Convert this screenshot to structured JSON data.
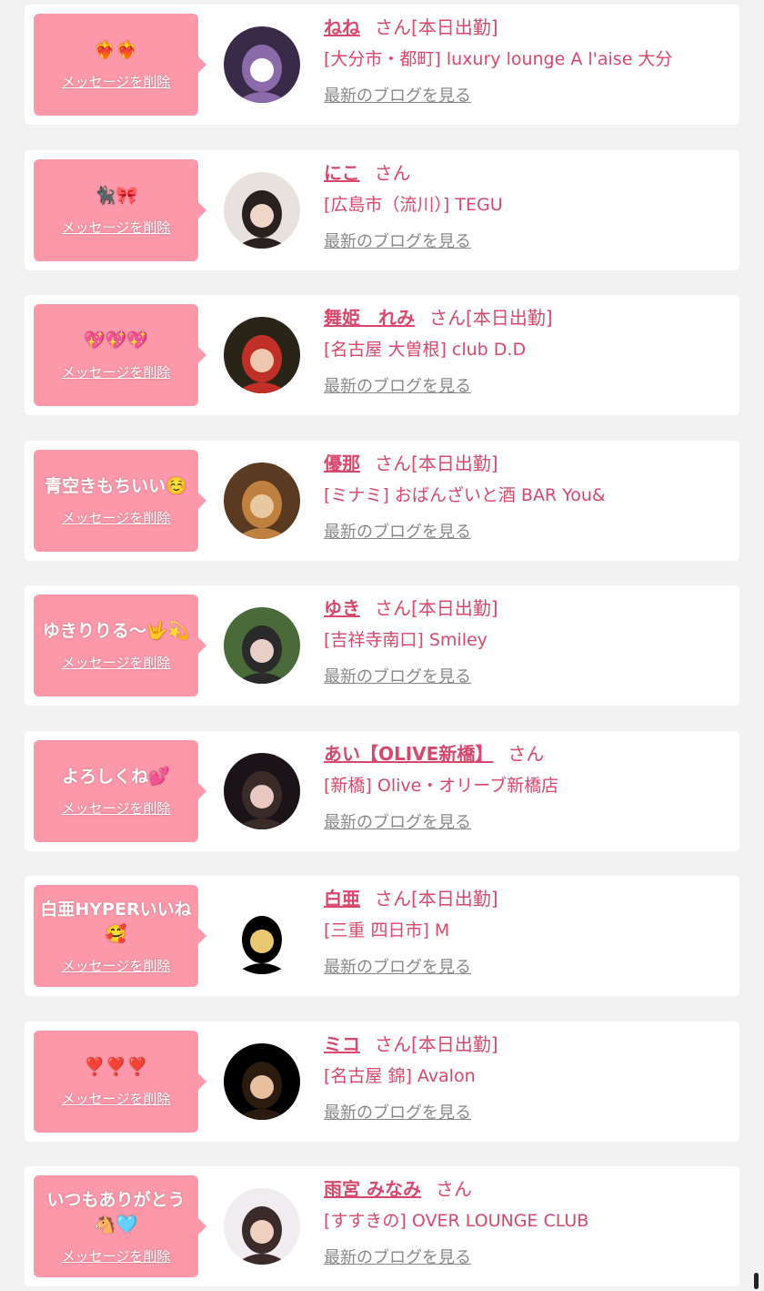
{
  "colors": {
    "accent": "#d8486c",
    "bubble": "#fc98aa",
    "muted": "#888888",
    "background": "#f2f2f2"
  },
  "common": {
    "delete_label": "メッセージを削除",
    "blog_label": "最新のブログを見る"
  },
  "messages": [
    {
      "text": "❤️‍🔥❤️‍🔥",
      "name": "ねね",
      "suffix": "さん",
      "status": "[本日出勤]",
      "shop": "[大分市・都町] luxury lounge A l'aise 大分",
      "avatar_colors": [
        "#3a2a4a",
        "#8a6aa8",
        "#ffffff"
      ]
    },
    {
      "text": "🐈‍⬛🎀",
      "name": "にこ",
      "suffix": "さん",
      "status": "",
      "shop": "[広島市（流川）] TEGU",
      "avatar_colors": [
        "#e8e2dc",
        "#2a2020",
        "#f0d6c8"
      ]
    },
    {
      "text": "💖💖💖",
      "name": "舞姫　れみ",
      "suffix": "さん",
      "status": "[本日出勤]",
      "shop": "[名古屋 大曽根] club D.D",
      "avatar_colors": [
        "#2a2418",
        "#c03028",
        "#f0c8b0"
      ]
    },
    {
      "text": "青空きもちいい☺️",
      "name": "優那",
      "suffix": "さん",
      "status": "[本日出勤]",
      "shop": "[ミナミ] おばんざいと酒 BAR You&",
      "avatar_colors": [
        "#5a3a20",
        "#c08040",
        "#e8c8a0"
      ]
    },
    {
      "text": "ゆきりりる〜🤟💫",
      "name": "ゆき",
      "suffix": "さん",
      "status": "[本日出勤]",
      "shop": "[吉祥寺南口] Smiley",
      "avatar_colors": [
        "#4a6a3a",
        "#2a2a2a",
        "#e8d0c8"
      ]
    },
    {
      "text": "よろしくね💕",
      "name": "あい【OLIVE新橋】",
      "suffix": "さん",
      "status": "",
      "shop": "[新橋] Olive・オリーブ新橋店",
      "avatar_colors": [
        "#1a1418",
        "#3a2a28",
        "#e8c8c0"
      ]
    },
    {
      "text": "白亜HYPERいいね🥰",
      "name": "白亜",
      "suffix": "さん",
      "status": "[本日出勤]",
      "shop": "[三重 四日市] M",
      "avatar_colors": [
        "#ffffff",
        "#000000",
        "#e8c870"
      ]
    },
    {
      "text": "❣️❣️❣️",
      "name": "ミコ",
      "suffix": "さん",
      "status": "[本日出勤]",
      "shop": "[名古屋 錦] Avalon",
      "avatar_colors": [
        "#000000",
        "#2a1a10",
        "#e8c0a0"
      ]
    },
    {
      "text": "いつもありがとう🐴🩵",
      "name": "雨宮 みなみ",
      "suffix": "さん",
      "status": "",
      "shop": "[すすきの] OVER LOUNGE CLUB",
      "avatar_colors": [
        "#f0ecf0",
        "#3a2a2a",
        "#f0d0c0"
      ]
    }
  ]
}
